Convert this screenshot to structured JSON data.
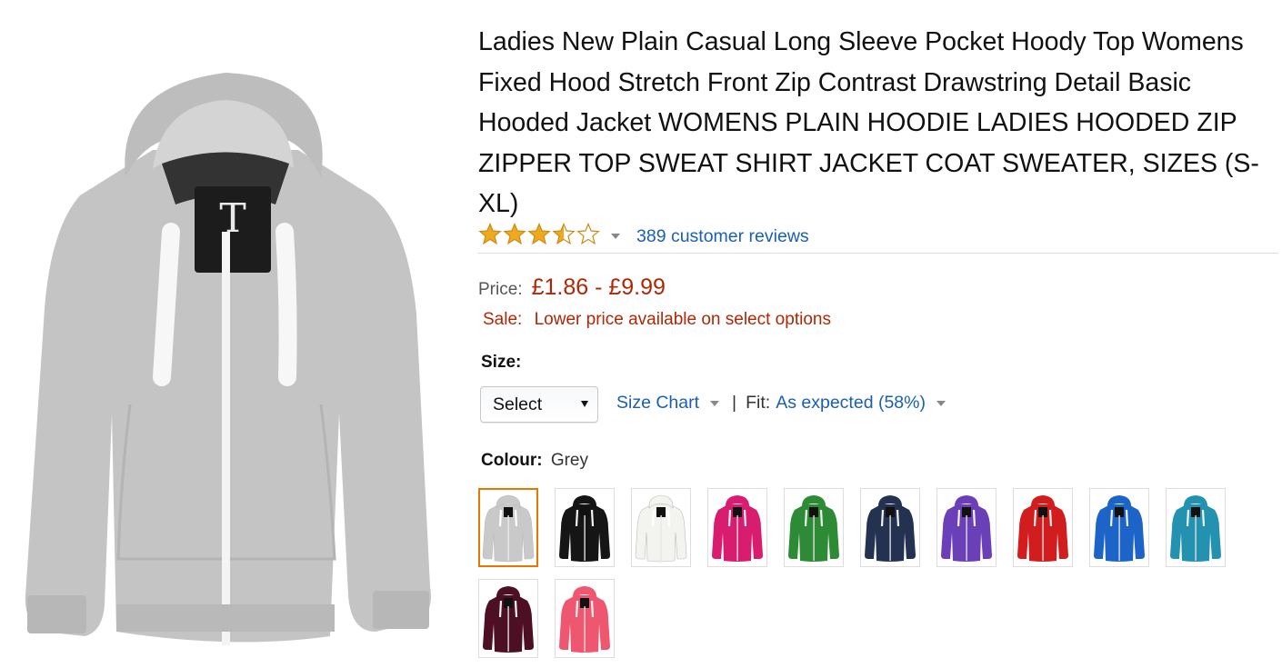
{
  "product": {
    "title": "Ladies New Plain Casual Long Sleeve Pocket Hoody Top Womens Fixed Hood Stretch Front Zip Contrast Drawstring Detail Basic Hooded Jacket WOMENS PLAIN HOODIE LADIES HOODED ZIP ZIPPER TOP SWEAT SHIRT JACKET COAT SWEATER, SIZES (S-XL)",
    "rating": 3.5,
    "rating_max": 5,
    "reviews_label": "389 customer reviews",
    "image_icon": "hoodie-image"
  },
  "price": {
    "label": "Price:",
    "value": "£1.86 - £9.99",
    "color": "#b12704"
  },
  "sale": {
    "label": "Sale:",
    "text": "Lower price available on select options"
  },
  "size": {
    "heading": "Size:",
    "selected": "Select",
    "chart_label": "Size Chart",
    "separator": "|",
    "fit_label": "Fit:",
    "fit_value": "As expected (58%)"
  },
  "colour": {
    "label": "Colour:",
    "selected": "Grey",
    "swatches": [
      {
        "name": "Grey",
        "hex": "#c9c9c9",
        "selected": true
      },
      {
        "name": "Black",
        "hex": "#151515",
        "selected": false
      },
      {
        "name": "White",
        "hex": "#f3f3ef",
        "selected": false
      },
      {
        "name": "Fuchsia",
        "hex": "#d81c6f",
        "selected": false
      },
      {
        "name": "Green",
        "hex": "#2e8b35",
        "selected": false
      },
      {
        "name": "Navy",
        "hex": "#243252",
        "selected": false
      },
      {
        "name": "Purple",
        "hex": "#6a3fb8",
        "selected": false
      },
      {
        "name": "Red",
        "hex": "#d11d1d",
        "selected": false
      },
      {
        "name": "Royal Blue",
        "hex": "#1c64c7",
        "selected": false
      },
      {
        "name": "Teal",
        "hex": "#2391b0",
        "selected": false
      },
      {
        "name": "Burgundy",
        "hex": "#4c0f24",
        "selected": false
      },
      {
        "name": "Coral Pink",
        "hex": "#ef5670",
        "selected": false
      }
    ]
  },
  "colors": {
    "link": "#1a5fb4",
    "star": "#f0a81e",
    "selected_border": "#e77600"
  }
}
